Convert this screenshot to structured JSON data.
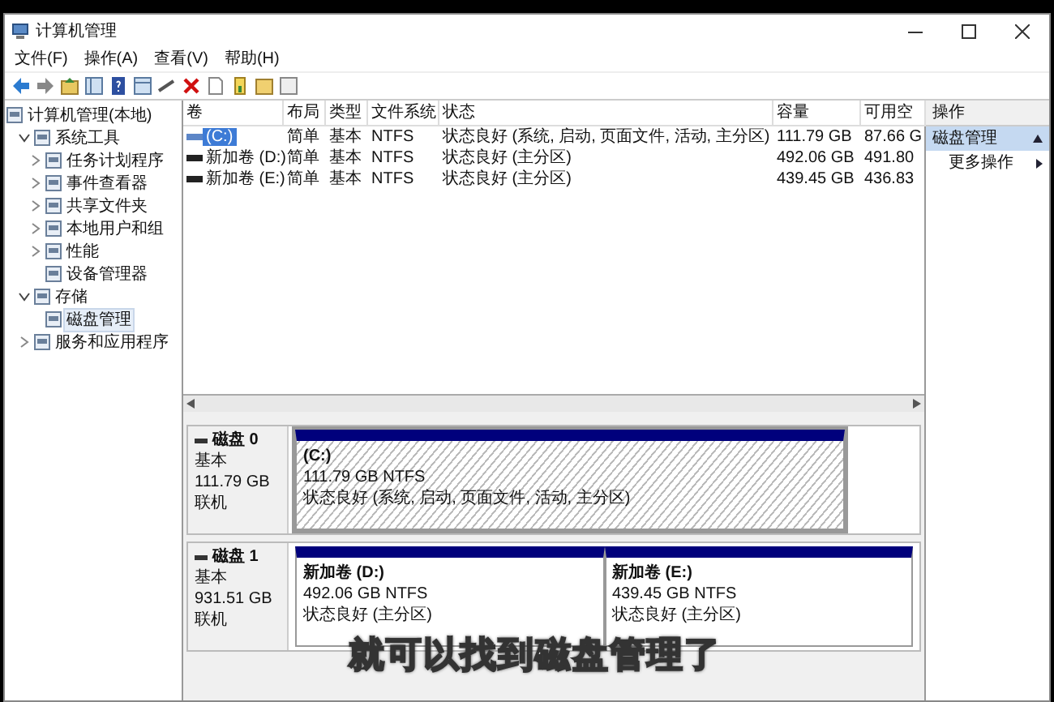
{
  "window": {
    "title": "计算机管理"
  },
  "menu": [
    "文件(F)",
    "操作(A)",
    "查看(V)",
    "帮助(H)"
  ],
  "tree": {
    "label": "计算机管理(本地)",
    "selected": false,
    "children": [
      {
        "label": "系统工具",
        "expanded": true,
        "selected": false,
        "children": [
          {
            "label": "任务计划程序",
            "expanded": false,
            "selected": false
          },
          {
            "label": "事件查看器",
            "expanded": false,
            "selected": false
          },
          {
            "label": "共享文件夹",
            "expanded": false,
            "selected": false
          },
          {
            "label": "本地用户和组",
            "expanded": false,
            "selected": false
          },
          {
            "label": "性能",
            "expanded": false,
            "selected": false
          },
          {
            "label": "设备管理器",
            "selected": false
          }
        ]
      },
      {
        "label": "存储",
        "expanded": true,
        "selected": false,
        "children": [
          {
            "label": "磁盘管理",
            "selected": true
          }
        ]
      },
      {
        "label": "服务和应用程序",
        "expanded": false,
        "selected": false
      }
    ]
  },
  "table": {
    "columns": [
      "卷",
      "布局",
      "类型",
      "文件系统",
      "状态",
      "容量",
      "可用空"
    ],
    "rows": [
      {
        "selected": true,
        "cells": [
          "(C:)",
          "简单",
          "基本",
          "NTFS",
          "状态良好 (系统, 启动, 页面文件, 活动, 主分区)",
          "111.79 GB",
          "87.66 G"
        ]
      },
      {
        "selected": false,
        "cells": [
          "新加卷 (D:)",
          "简单",
          "基本",
          "NTFS",
          "状态良好 (主分区)",
          "492.06 GB",
          "491.80"
        ]
      },
      {
        "selected": false,
        "cells": [
          "新加卷 (E:)",
          "简单",
          "基本",
          "NTFS",
          "状态良好 (主分区)",
          "439.45 GB",
          "436.83"
        ]
      }
    ]
  },
  "disks": [
    {
      "name": "磁盘 0",
      "type": "基本",
      "size": "111.79 GB",
      "status": "联机",
      "partitions": [
        {
          "label": "(C:)",
          "size": "111.79 GB NTFS",
          "status": "状态良好 (系统, 启动, 页面文件, 活动, 主分区)",
          "selected": true
        }
      ]
    },
    {
      "name": "磁盘 1",
      "type": "基本",
      "size": "931.51 GB",
      "status": "联机",
      "partitions": [
        {
          "label": "新加卷 (D:)",
          "size": "492.06 GB NTFS",
          "status": "状态良好 (主分区)",
          "selected": false
        },
        {
          "label": "新加卷 (E:)",
          "size": "439.45 GB NTFS",
          "status": "状态良好 (主分区)",
          "selected": false
        }
      ]
    }
  ],
  "actions": {
    "title": "操作",
    "section": "磁盘管理",
    "items": [
      "更多操作"
    ]
  },
  "subtitle": "就可以找到磁盘管理了"
}
